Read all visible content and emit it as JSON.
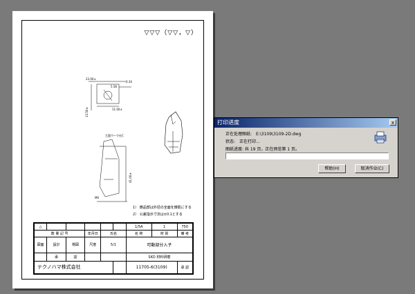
{
  "sheet": {
    "corner_symbol": "▽▽▽（▽▽，▽）",
    "notes": [
      "1）   鋳品部は外径の全面を鋳肌にする",
      "2）   公差指示寸法は±0.1とする"
    ],
    "title_block": {
      "row1": [
        "△",
        "",
        "",
        "",
        "",
        "",
        "1/5A",
        "1",
        "750"
      ],
      "row2": [
        "数  量  記  号",
        "年月日",
        "氏名",
        "名  称",
        "材  質",
        "備  考"
      ],
      "row3": [
        "図面",
        "設計",
        "検図",
        "尺度"
      ],
      "part_name": "可動部分入子",
      "scale": "5/1",
      "row4": [
        "承",
        "認"
      ],
      "material": "SKD 材料研磨",
      "drawing_number": "11705-6(3109)",
      "company": "テクノハマ株式会社",
      "stamp_label": "承 認"
    }
  },
  "dialog": {
    "title": "打印进度",
    "close_glyph": "x",
    "processing_label": "正在处理图纸:",
    "processing_value": "E:\\3109\\3109-2D.dwg",
    "status_label": "状态:",
    "status_value": "正在打印...",
    "progress_text": "图纸进度: 共 19 页，正在预览第 1 页。",
    "progress_value": 0.0,
    "help_button": "帮助(H)",
    "cancel_button": "取消作业(C)"
  }
}
